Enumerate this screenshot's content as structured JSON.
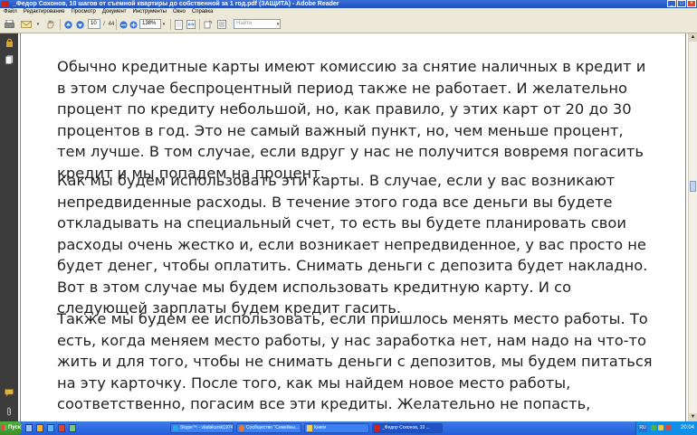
{
  "window": {
    "title": "_Федор Сохонов, 10 шагов от съемной квартиры до  собственной за 1 год.pdf (ЗАЩИТА) - Adobe Reader",
    "minimize_glyph": "_",
    "maximize_glyph": "□",
    "close_glyph": "×"
  },
  "menu": [
    "Файл",
    "Редактирование",
    "Просмотр",
    "Документ",
    "Инструменты",
    "Окно",
    "Справка"
  ],
  "toolbar": {
    "page_current": "10",
    "page_total": "44",
    "page_separator": "/",
    "zoom": "138%",
    "find_placeholder": "Найти"
  },
  "document": {
    "paragraphs": [
      "Обычно  кредитные  карты имеют комиссию за снятие наличных в кредит и в этом случае беспроцентный период также не работает. И желательно процент по кредиту небольшой, но, как правило, у этих карт от  20 до 30 процентов в год. Это не самый важный пункт, но, чем меньше процент, тем лучше. В том случае, если вдруг у нас не получится вовремя погасить кредит и мы попадем на процент.",
      "Как мы будем использовать эти карты. В случае, если у вас возникают непредвиденные расходы. В течение этого года все деньги вы будете откладывать на специальный счет, то есть вы будете планировать свои расходы очень жестко и, если возникает непредвиденное,  у вас просто не будет денег, чтобы оплатить. Снимать деньги с депозита будет накладно. Вот в этом случае мы будем использовать кредитную карту. И со следующей зарплаты будем кредит гасить.",
      "Также мы будем ее использовать, если пришлось  менять место работы.  То есть, когда меняем место работы, у нас заработка нет, нам надо на что-то жить и для того, чтобы не снимать деньги с депозитов, мы будем питаться на эту карточку. После того, как мы найдем новое место работы, соответственно, погасим все эти кредиты. Желательно не попасть, конечно, на проценты."
    ]
  },
  "taskbar": {
    "start_label": "Пуск",
    "tasks": [
      {
        "label": "Skype™ - vladakursk1974",
        "active": false
      },
      {
        "label": "Сообщество \"Семейны...",
        "active": false
      },
      {
        "label": "Книги",
        "active": false
      },
      {
        "label": "_Федор Сохонов, 10 ...",
        "active": true
      }
    ],
    "tray": {
      "language": "RU",
      "clock": "20:04"
    }
  }
}
